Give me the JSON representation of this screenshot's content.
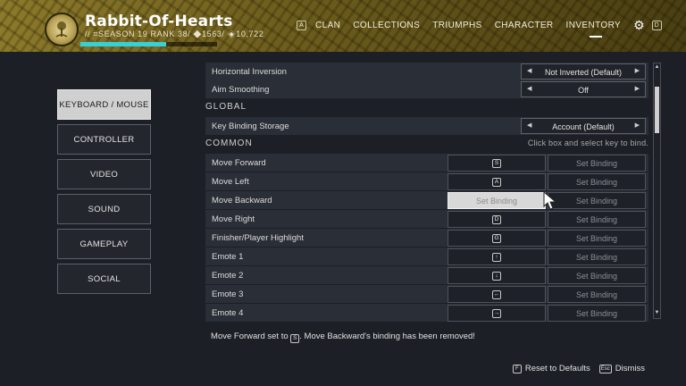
{
  "header": {
    "character_name": "Rabbit-Of-Hearts",
    "subtitle": "// ⌗SEASON 19 RANK 38/ ◆1563/ ◈10,722",
    "season_progress": 0.63,
    "nav_key_left": "A",
    "nav_items": [
      "CLAN",
      "COLLECTIONS",
      "TRIUMPHS",
      "CHARACTER",
      "INVENTORY"
    ],
    "nav_key_right": "D"
  },
  "menu": {
    "items": [
      {
        "label": "KEYBOARD / MOUSE",
        "active": true
      },
      {
        "label": "CONTROLLER",
        "active": false
      },
      {
        "label": "VIDEO",
        "active": false
      },
      {
        "label": "SOUND",
        "active": false
      },
      {
        "label": "GAMEPLAY",
        "active": false
      },
      {
        "label": "SOCIAL",
        "active": false
      }
    ]
  },
  "settings": {
    "horizontal_inversion": {
      "label": "Horizontal Inversion",
      "value": "Not Inverted (Default)"
    },
    "aim_smoothing": {
      "label": "Aim Smoothing",
      "value": "Off"
    },
    "global_section": "GLOBAL",
    "key_binding_storage": {
      "label": "Key Binding Storage",
      "value": "Account (Default)"
    },
    "common_section": "COMMON",
    "common_hint": "Click box and select key to bind.",
    "set_binding_label": "Set Binding",
    "bindings": [
      {
        "label": "Move Forward",
        "primary": "S",
        "secondary": "Set Binding"
      },
      {
        "label": "Move Left",
        "primary": "A",
        "secondary": "Set Binding"
      },
      {
        "label": "Move Backward",
        "primary": "Set Binding",
        "secondary": "Set Binding"
      },
      {
        "label": "Move Right",
        "primary": "D",
        "secondary": "Set Binding"
      },
      {
        "label": "Finisher/Player Highlight",
        "primary": "G",
        "secondary": "Set Binding"
      },
      {
        "label": "Emote 1",
        "primary": "↑",
        "secondary": "Set Binding"
      },
      {
        "label": "Emote 2",
        "primary": "↓",
        "secondary": "Set Binding"
      },
      {
        "label": "Emote 3",
        "primary": "←",
        "secondary": "Set Binding"
      },
      {
        "label": "Emote 4",
        "primary": "→",
        "secondary": "Set Binding"
      }
    ]
  },
  "status": {
    "part1": "Move Forward set to",
    "key": "S",
    "part2": ". Move Backward's binding has been removed!"
  },
  "footer": {
    "reset_key": "F",
    "reset_label": "Reset to Defaults",
    "dismiss_key": "Esc",
    "dismiss_label": "Dismiss"
  },
  "colors": {
    "accent": "#35d0d8",
    "banner": "#7a6a22",
    "background": "#1c1f26"
  }
}
